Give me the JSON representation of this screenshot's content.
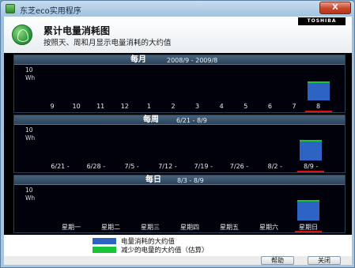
{
  "window": {
    "title": "东芝eco实用程序",
    "close_label": "X"
  },
  "header": {
    "brand": "TOSHIBA",
    "title": "累计电量消耗图",
    "subtitle": "按照天、周和月显示电量消耗的大约值"
  },
  "charts": [
    {
      "name": "每月",
      "range": "2008/9 - 2009/8",
      "y_max": "10",
      "y_unit": "Wh",
      "labels": [
        "9",
        "10",
        "11",
        "12",
        "1",
        "2",
        "3",
        "4",
        "5",
        "6",
        "7",
        "8"
      ],
      "selected_label": "8",
      "current_value": 6,
      "saved_value": 0.2
    },
    {
      "name": "每周",
      "range": "6/21 - 8/9",
      "y_max": "10",
      "y_unit": "Wh",
      "labels": [
        "6/21 -",
        "6/28 -",
        "7/5 -",
        "7/12 -",
        "7/19 -",
        "7/26 -",
        "8/2 -",
        "8/9 -"
      ],
      "selected_label": "8/9 -",
      "current_value": 6.5,
      "saved_value": 0.2
    },
    {
      "name": "每日",
      "range": "8/3 - 8/9",
      "y_max": "10",
      "y_unit": "Wh",
      "labels": [
        "星期一",
        "星期二",
        "星期三",
        "星期四",
        "星期五",
        "星期六",
        "星期日"
      ],
      "selected_label": "星期日",
      "current_value": 6.5,
      "saved_value": 0.2
    }
  ],
  "chart_data": [
    {
      "type": "bar",
      "title": "每月",
      "subtitle": "2008/9 - 2009/8",
      "ylabel": "Wh",
      "ylim": [
        0,
        10
      ],
      "categories": [
        "9",
        "10",
        "11",
        "12",
        "1",
        "2",
        "3",
        "4",
        "5",
        "6",
        "7",
        "8"
      ],
      "series": [
        {
          "name": "电量消耗的大约值",
          "values": [
            0,
            0,
            0,
            0,
            0,
            0,
            0,
            0,
            0,
            0,
            0,
            6
          ]
        },
        {
          "name": "减少的电量的大约值（估算）",
          "values": [
            0,
            0,
            0,
            0,
            0,
            0,
            0,
            0,
            0,
            0,
            0,
            0.2
          ]
        }
      ]
    },
    {
      "type": "bar",
      "title": "每周",
      "subtitle": "6/21 - 8/9",
      "ylabel": "Wh",
      "ylim": [
        0,
        10
      ],
      "categories": [
        "6/21 -",
        "6/28 -",
        "7/5 -",
        "7/12 -",
        "7/19 -",
        "7/26 -",
        "8/2 -",
        "8/9 -"
      ],
      "series": [
        {
          "name": "电量消耗的大约值",
          "values": [
            0,
            0,
            0,
            0,
            0,
            0,
            0,
            6.5
          ]
        },
        {
          "name": "减少的电量的大约值（估算）",
          "values": [
            0,
            0,
            0,
            0,
            0,
            0,
            0,
            0.2
          ]
        }
      ]
    },
    {
      "type": "bar",
      "title": "每日",
      "subtitle": "8/3 - 8/9",
      "ylabel": "Wh",
      "ylim": [
        0,
        10
      ],
      "categories": [
        "星期一",
        "星期二",
        "星期三",
        "星期四",
        "星期五",
        "星期六",
        "星期日"
      ],
      "series": [
        {
          "name": "电量消耗的大约值",
          "values": [
            0,
            0,
            0,
            0,
            0,
            0,
            6.5
          ]
        },
        {
          "name": "减少的电量的大约值（估算）",
          "values": [
            0,
            0,
            0,
            0,
            0,
            0,
            0.2
          ]
        }
      ]
    }
  ],
  "legend": {
    "items": [
      {
        "label": "电量消耗的大约值",
        "color": "#2d63c2"
      },
      {
        "label": "减少的电量的大约值（估算）",
        "color": "#19c43a"
      }
    ]
  },
  "footer": {
    "help_label": "帮助",
    "close_label": "关闭"
  },
  "colors": {
    "bar": "#2d63c2",
    "saved": "#19c43a",
    "selected_underline": "#e01010"
  }
}
